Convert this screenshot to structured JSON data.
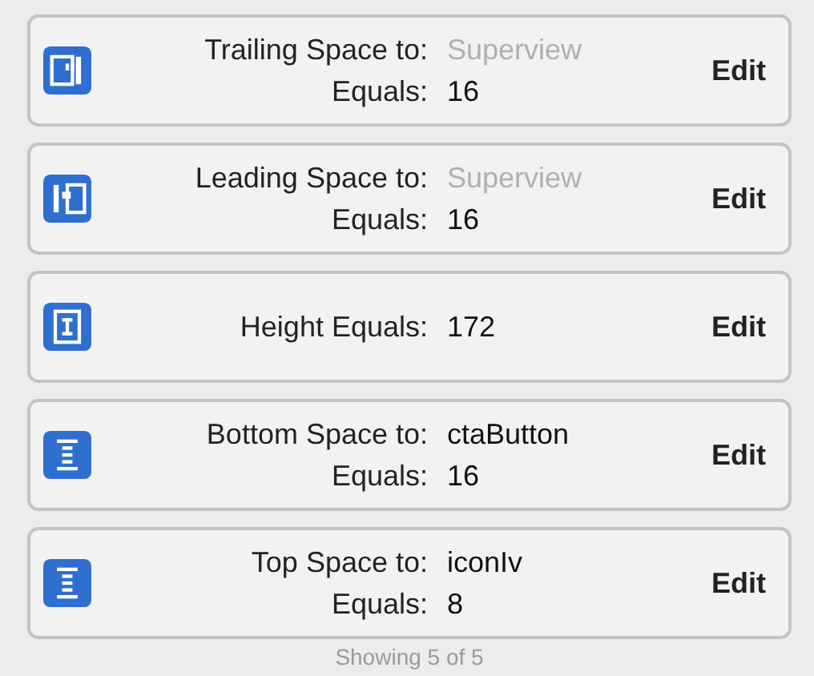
{
  "constraints": [
    {
      "kind": "trailing",
      "lines": [
        {
          "label": "Trailing Space to:",
          "value": "Superview",
          "dimmed": true
        },
        {
          "label": "Equals:",
          "value": "16",
          "dimmed": false
        }
      ],
      "action": "Edit"
    },
    {
      "kind": "leading",
      "lines": [
        {
          "label": "Leading Space to:",
          "value": "Superview",
          "dimmed": true
        },
        {
          "label": "Equals:",
          "value": "16",
          "dimmed": false
        }
      ],
      "action": "Edit"
    },
    {
      "kind": "height",
      "lines": [
        {
          "label": "Height Equals:",
          "value": "172",
          "dimmed": false
        }
      ],
      "action": "Edit"
    },
    {
      "kind": "vertical",
      "lines": [
        {
          "label": "Bottom Space to:",
          "value": "ctaButton",
          "dimmed": false
        },
        {
          "label": "Equals:",
          "value": "16",
          "dimmed": false
        }
      ],
      "action": "Edit"
    },
    {
      "kind": "vertical",
      "lines": [
        {
          "label": "Top Space to:",
          "value": "iconIv",
          "dimmed": false
        },
        {
          "label": "Equals:",
          "value": "8",
          "dimmed": false
        }
      ],
      "action": "Edit"
    }
  ],
  "footer": "Showing 5 of 5"
}
